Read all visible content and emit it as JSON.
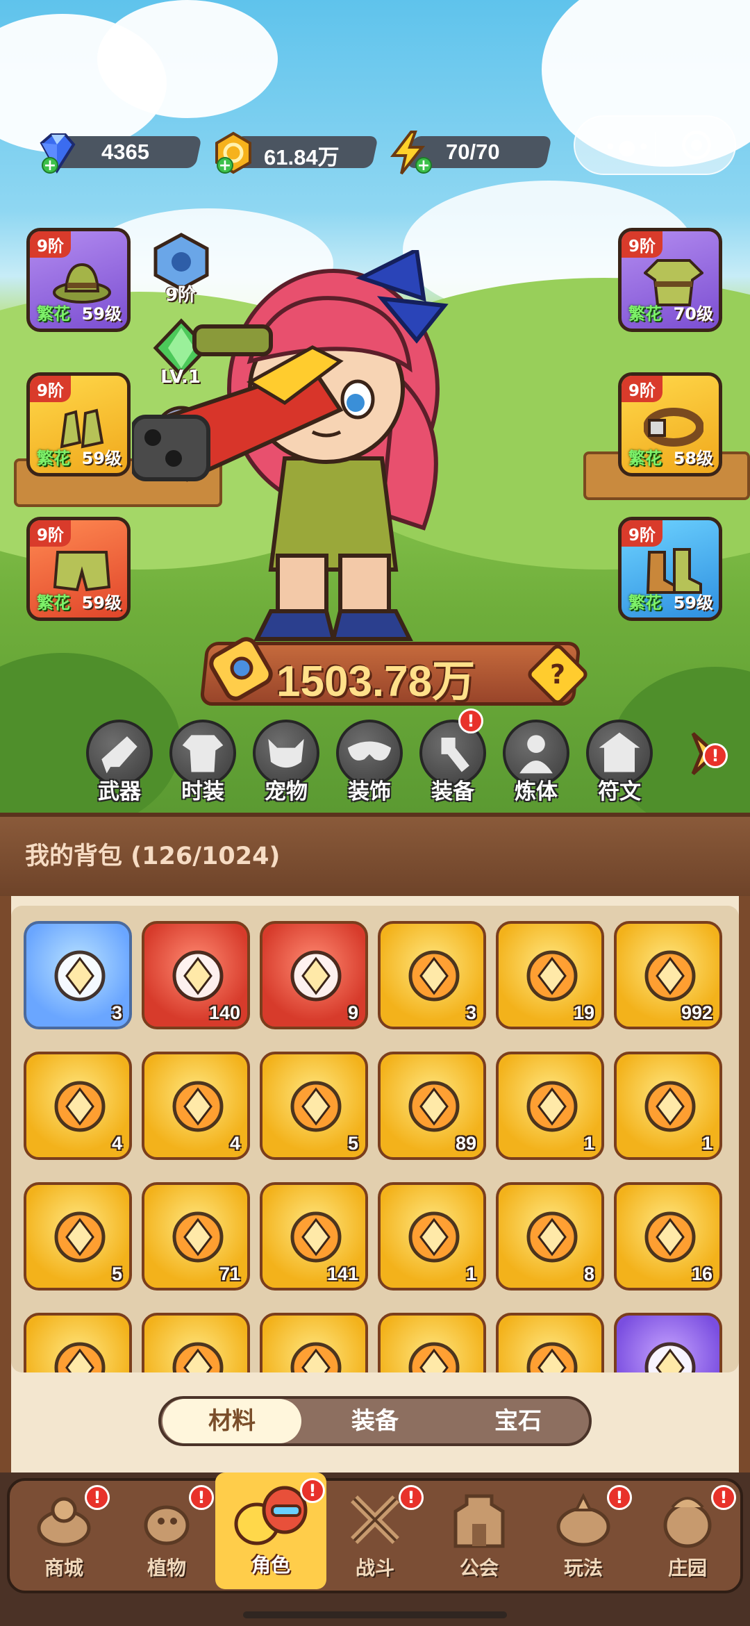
{
  "resources": {
    "diamonds": "4365",
    "coins": "61.84万",
    "energy": "70/70"
  },
  "equipment_left": [
    {
      "tier": "9阶",
      "name": "繁花",
      "level": "59级",
      "rarity": "purple"
    },
    {
      "tier": "9阶",
      "name": "繁花",
      "level": "59级",
      "rarity": "gold"
    },
    {
      "tier": "9阶",
      "name": "繁花",
      "level": "59级",
      "rarity": "red-gold"
    }
  ],
  "equipment_right": [
    {
      "tier": "9阶",
      "name": "繁花",
      "level": "70级",
      "rarity": "purple"
    },
    {
      "tier": "9阶",
      "name": "繁花",
      "level": "58级",
      "rarity": "gold"
    },
    {
      "tier": "9阶",
      "name": "繁花",
      "level": "59级",
      "rarity": "blue"
    }
  ],
  "mini_badges": {
    "pet_tier": "9阶",
    "gem_level": "LV.1",
    "star_count": "0"
  },
  "power": "1503.78万",
  "feature_menu": [
    {
      "label": "武器",
      "icon": "weapon-icon",
      "alert": false
    },
    {
      "label": "时装",
      "icon": "outfit-icon",
      "alert": false
    },
    {
      "label": "宠物",
      "icon": "pet-icon",
      "alert": false
    },
    {
      "label": "装饰",
      "icon": "mask-icon",
      "alert": false
    },
    {
      "label": "装备",
      "icon": "equipment-icon",
      "alert": true
    },
    {
      "label": "炼体",
      "icon": "body-refine-icon",
      "alert": false
    },
    {
      "label": "符文",
      "icon": "rune-icon",
      "alert": false
    }
  ],
  "backpack": {
    "title": "我的背包 (126/1024)",
    "items": [
      {
        "count": "3",
        "frame": "blue",
        "icon": "duck-flower-icon"
      },
      {
        "count": "140",
        "frame": "red",
        "icon": "star-crystal-icon"
      },
      {
        "count": "9",
        "frame": "red",
        "icon": "apple-potion-icon"
      },
      {
        "count": "3",
        "frame": "gold",
        "icon": "water-drop-icon"
      },
      {
        "count": "19",
        "frame": "gold",
        "icon": "skull-scroll-icon"
      },
      {
        "count": "992",
        "frame": "gold",
        "icon": "basket-icon"
      },
      {
        "count": "4",
        "frame": "gold",
        "icon": "ruby-key-icon"
      },
      {
        "count": "4",
        "frame": "gold",
        "icon": "gold-key-icon"
      },
      {
        "count": "5",
        "frame": "gold",
        "icon": "emerald-key-icon"
      },
      {
        "count": "89",
        "frame": "gold",
        "icon": "prism-icon"
      },
      {
        "count": "1",
        "frame": "gold",
        "icon": "mushroom-icon"
      },
      {
        "count": "1",
        "frame": "gold",
        "icon": "orb-icon"
      },
      {
        "count": "5",
        "frame": "gold",
        "icon": "yellow-flower-icon"
      },
      {
        "count": "71",
        "frame": "gold",
        "icon": "rune-stone-icon"
      },
      {
        "count": "141",
        "frame": "gold",
        "icon": "orange-potion-icon"
      },
      {
        "count": "1",
        "frame": "gold",
        "icon": "peach-icon"
      },
      {
        "count": "8",
        "frame": "gold",
        "icon": "flower-pot-icon"
      },
      {
        "count": "16",
        "frame": "gold",
        "icon": "spray-can-icon"
      },
      {
        "count": "",
        "frame": "gold",
        "icon": "stump-icon"
      },
      {
        "count": "",
        "frame": "gold",
        "icon": "can-icon"
      },
      {
        "count": "",
        "frame": "gold",
        "icon": "duck-puzzle-icon"
      },
      {
        "count": "",
        "frame": "gold",
        "icon": "shell-icon"
      },
      {
        "count": "",
        "frame": "gold",
        "icon": "knot-icon"
      },
      {
        "count": "",
        "frame": "purple",
        "icon": "purple-potion-icon"
      }
    ]
  },
  "bag_tabs": {
    "materials": "材料",
    "equipment": "装备",
    "gems": "宝石",
    "active": "材料"
  },
  "bottom_nav": [
    {
      "label": "商城",
      "alert": true
    },
    {
      "label": "植物",
      "alert": true
    },
    {
      "label": "角色",
      "alert": true,
      "active": true
    },
    {
      "label": "战斗",
      "alert": true
    },
    {
      "label": "公会",
      "alert": false
    },
    {
      "label": "玩法",
      "alert": true
    },
    {
      "label": "庄园",
      "alert": true
    }
  ],
  "colors": {
    "sky": "#5fc3ec",
    "grass": "#8cc951",
    "wood": "#7b4e35",
    "accent_gold": "#ffcd4a",
    "alert_red": "#e8322a"
  }
}
